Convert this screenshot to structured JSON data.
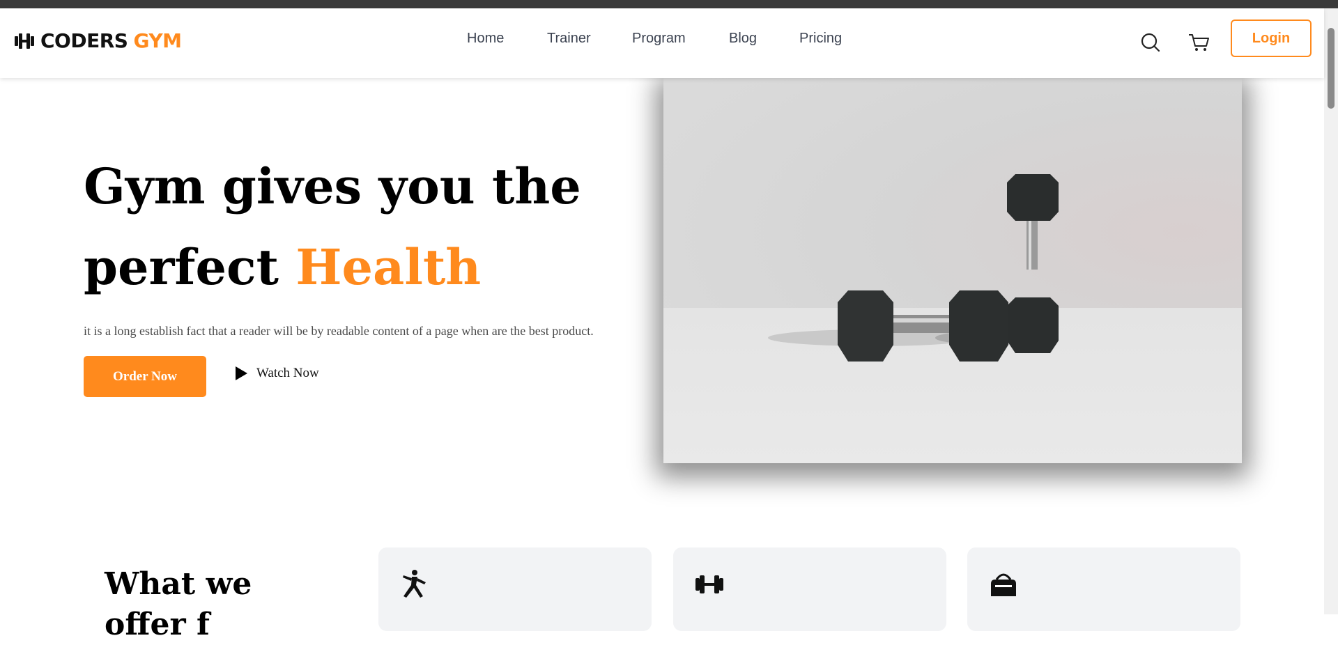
{
  "brand": {
    "name_part1": "CODERS",
    "name_part2": "GYM",
    "accent_color": "#ff8a1d"
  },
  "nav": {
    "links": [
      "Home",
      "Trainer",
      "Program",
      "Blog",
      "Pricing"
    ],
    "login_label": "Login",
    "icons": [
      "search-icon",
      "cart-icon"
    ]
  },
  "hero": {
    "title_line1": "Gym gives you the",
    "title_line2_prefix": "perfect",
    "title_line2_accent": "Health",
    "description": "it is a long establish fact that a reader will be by readable content of a page when are the best product.",
    "order_button": "Order Now",
    "watch_label": "Watch Now"
  },
  "offer": {
    "title": "What we offer f",
    "card_icons": [
      "yoga-pose-icon",
      "dumbbell-icon",
      "gym-bag-icon"
    ]
  }
}
